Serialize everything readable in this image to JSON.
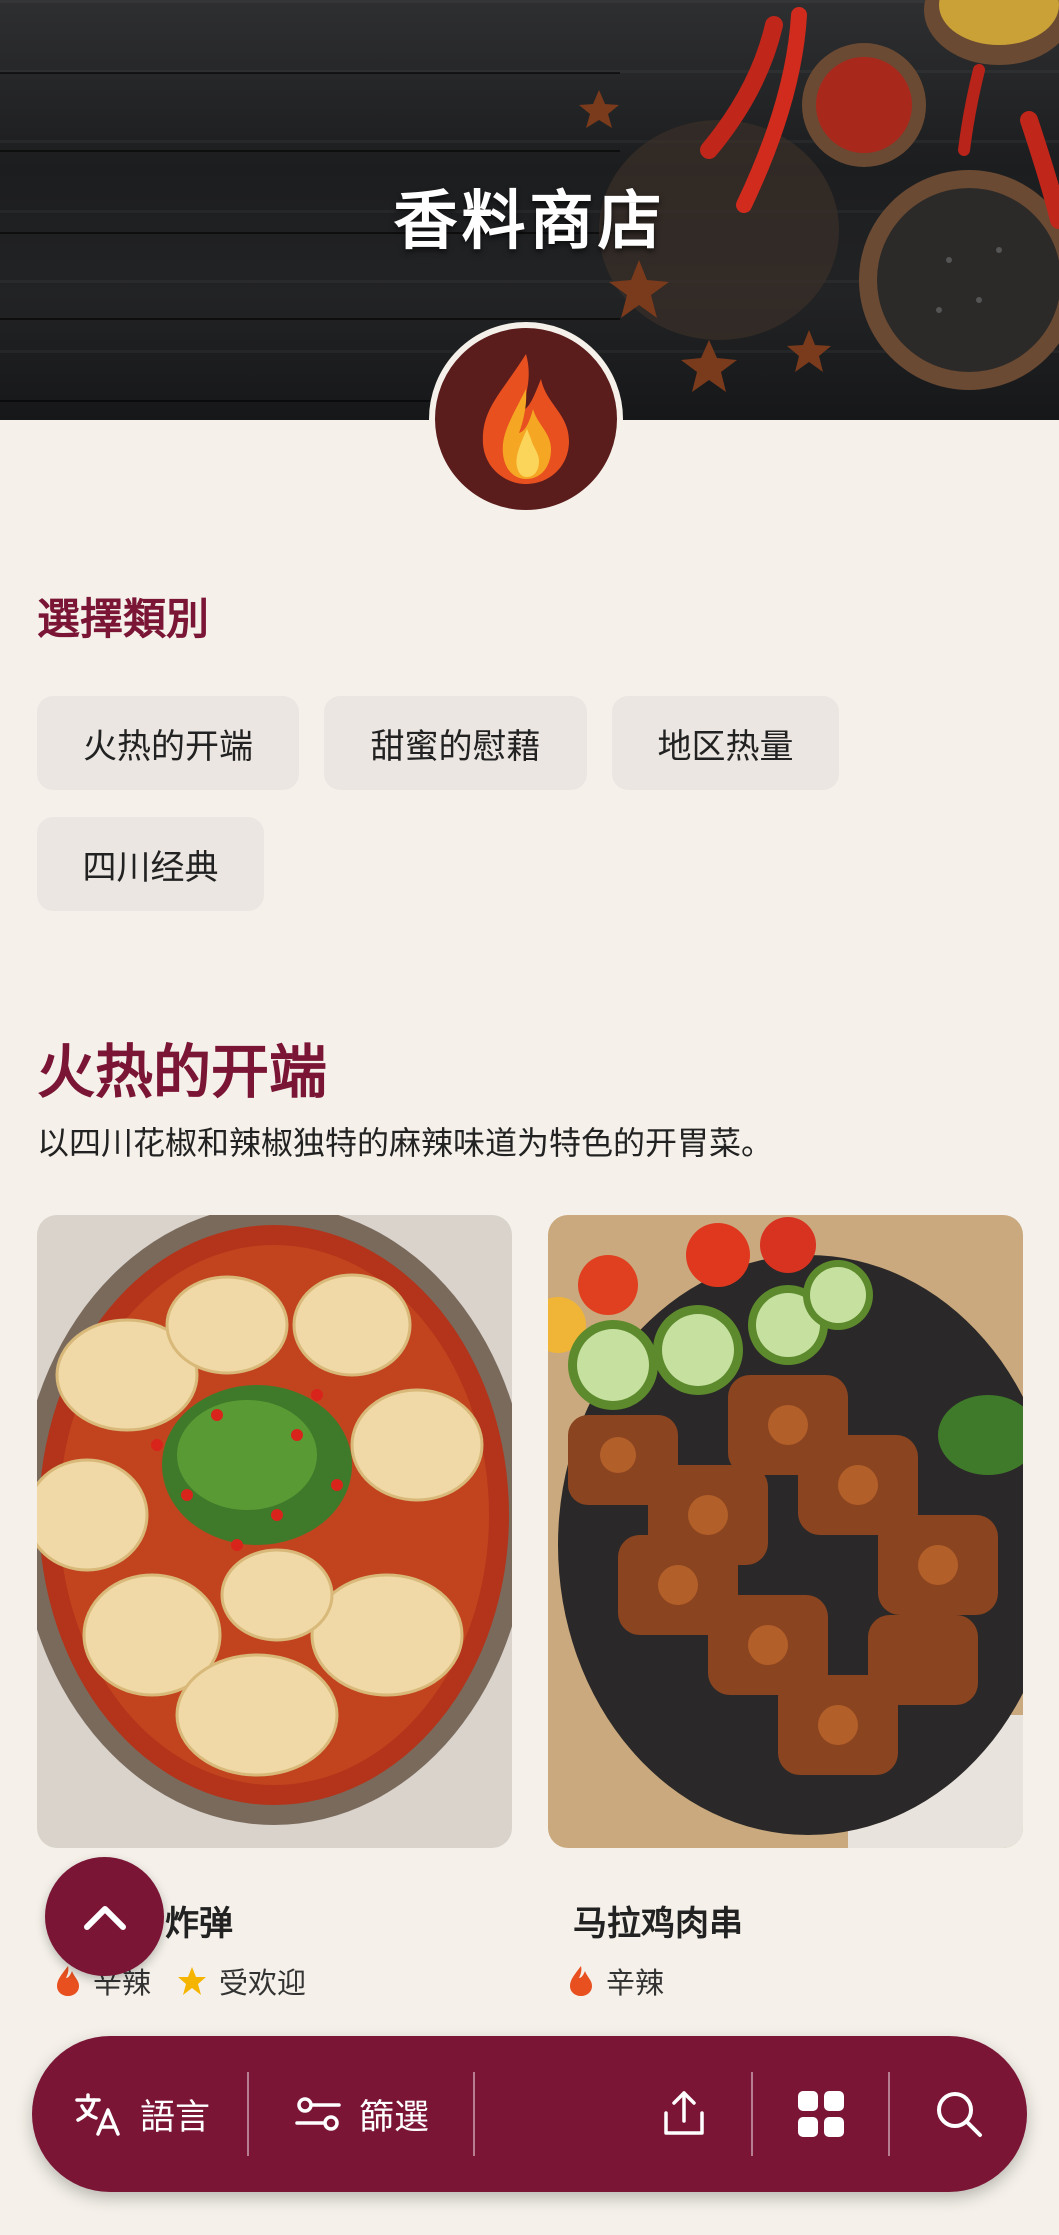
{
  "hero": {
    "title": "香料商店"
  },
  "category_section": {
    "title": "選擇類別",
    "chips": [
      "火热的开端",
      "甜蜜的慰藉",
      "地区热量",
      "四川经典"
    ]
  },
  "section": {
    "title": "火热的开端",
    "description": "以四川花椒和辣椒独特的麻辣味道为特色的开胃菜。"
  },
  "products": [
    {
      "name": "炸弹",
      "tags": [
        "辛辣",
        "受欢迎"
      ]
    },
    {
      "name": "马拉鸡肉串",
      "tags": [
        "辛辣"
      ]
    }
  ],
  "bottom_bar": {
    "language_label": "語言",
    "filter_label": "篩選"
  },
  "colors": {
    "accent": "#7a1535",
    "background": "#f5f1ea",
    "chip": "#ebe6e1"
  }
}
